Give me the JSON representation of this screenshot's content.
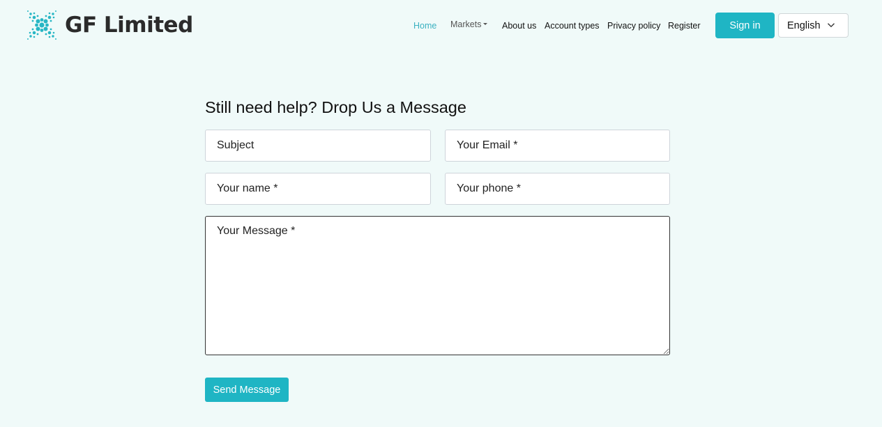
{
  "brand": {
    "name": "GF Limited",
    "logo_icon": "dotted-x-logo-icon",
    "accent_color": "#1fb5c4"
  },
  "nav": {
    "items": [
      {
        "label": "Home",
        "active": true
      },
      {
        "label": "Markets",
        "has_dropdown": true
      },
      {
        "label": "About us"
      },
      {
        "label": "Account types"
      },
      {
        "label": "Privacy policy"
      },
      {
        "label": "Register"
      }
    ],
    "sign_in_label": "Sign in",
    "language": {
      "selected": "English",
      "icon": "chevron-down-icon"
    }
  },
  "contact_form": {
    "title": "Still need help? Drop Us a Message",
    "fields": {
      "subject": {
        "placeholder": "Subject",
        "value": ""
      },
      "email": {
        "placeholder": "Your Email *",
        "value": ""
      },
      "name": {
        "placeholder": "Your name *",
        "value": ""
      },
      "phone": {
        "placeholder": "Your phone *",
        "value": ""
      },
      "message": {
        "placeholder": "Your Message *",
        "value": ""
      }
    },
    "submit_label": "Send Message"
  }
}
